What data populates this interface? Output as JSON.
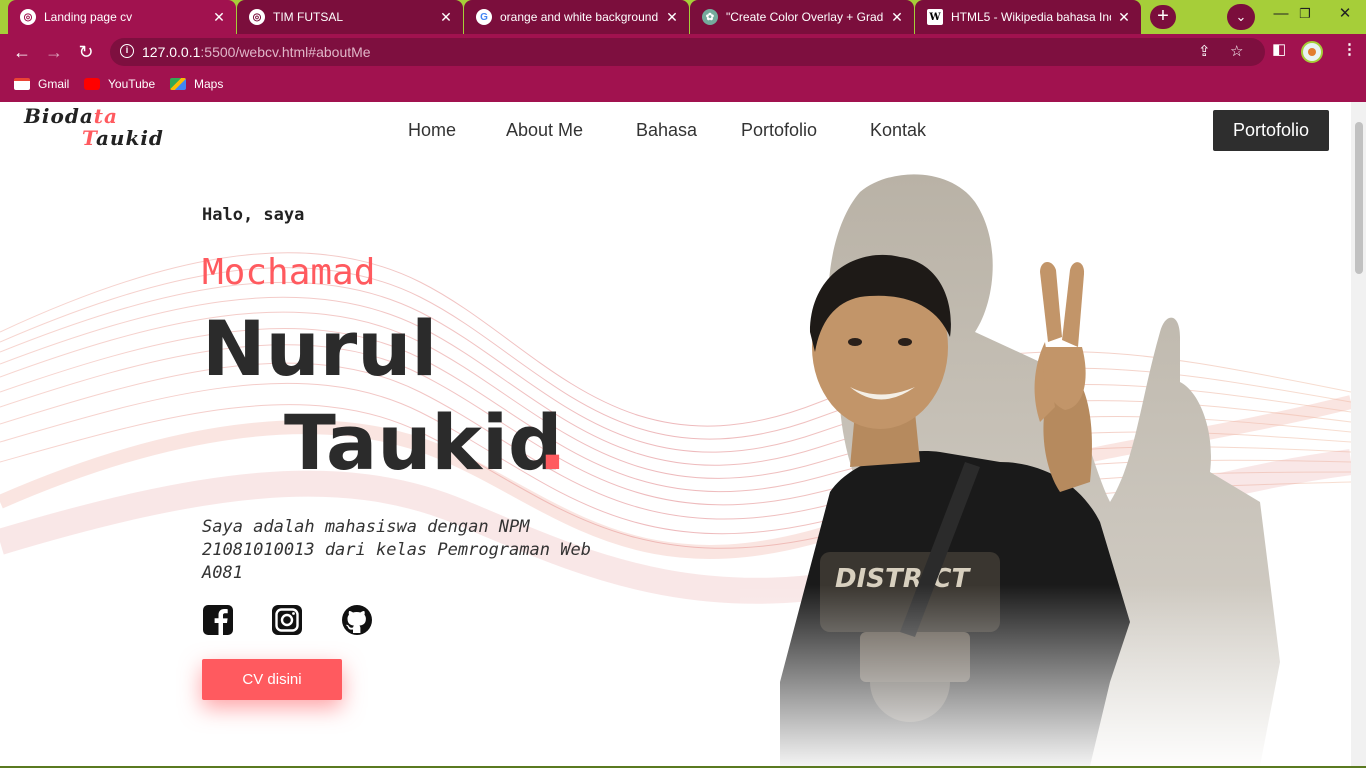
{
  "browser": {
    "tabs": [
      {
        "title": "Landing page cv",
        "active": true,
        "icon": "globe-icon"
      },
      {
        "title": "TIM FUTSAL",
        "active": false,
        "icon": "globe-icon"
      },
      {
        "title": "orange and white background",
        "active": false,
        "icon": "google-icon"
      },
      {
        "title": "\"Create Color Overlay + Gradie",
        "active": false,
        "icon": "chatgpt-icon"
      },
      {
        "title": "HTML5 - Wikipedia bahasa Ind",
        "active": false,
        "icon": "wikipedia-icon"
      }
    ],
    "url_host": "127.0.0.1",
    "url_rest": ":5500/webcv.html#aboutMe",
    "bookmarks": [
      {
        "label": "Gmail",
        "icon": "gmail-icon"
      },
      {
        "label": "YouTube",
        "icon": "youtube-icon"
      },
      {
        "label": "Maps",
        "icon": "maps-icon"
      }
    ],
    "colors": {
      "tabstrip": "#a6ce39",
      "toolbar": "#a1124f",
      "inactive_tab": "#7b0e3c"
    }
  },
  "site": {
    "logo": {
      "line1_a": "Bioda",
      "line1_b": "ta",
      "line2_a": "T",
      "line2_b": "aukid"
    },
    "nav": [
      "Home",
      "About Me",
      "Bahasa",
      "Portofolio",
      "Kontak"
    ],
    "cta": "Portofolio",
    "hero": {
      "greeting": "Halo, saya",
      "first_name": "Mochamad",
      "name_line1": "Nurul",
      "name_line2": "Taukid",
      "name_dot": ".",
      "description": "Saya adalah mahasiswa dengan NPM 21081010013 dari kelas Pemrograman Web A081",
      "social": [
        "facebook-icon",
        "instagram-icon",
        "github-icon"
      ],
      "button": "CV disini"
    },
    "colors": {
      "accent": "#ff5a5f",
      "dark": "#2b2b2b",
      "cta_bg": "#2e2e2e"
    }
  }
}
